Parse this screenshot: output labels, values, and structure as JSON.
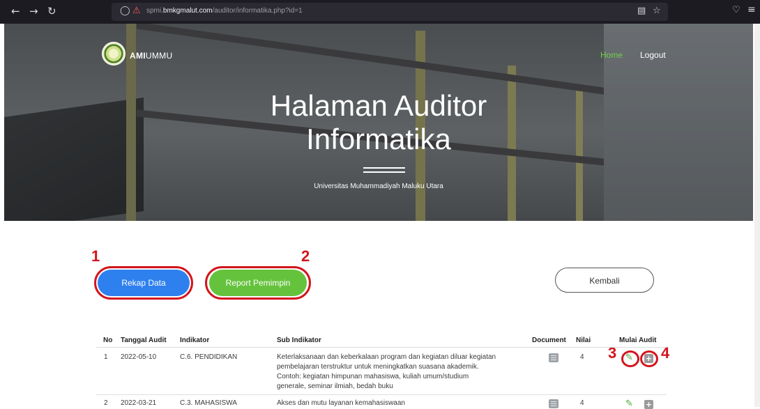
{
  "browser": {
    "url_prefix": "spmi.",
    "url_domain": "bmkgmalut.com",
    "url_path": "/auditor/informatika.php?id=1",
    "back_icon": "arrow-left-icon",
    "forward_icon": "arrow-right-icon",
    "reload_icon": "reload-icon"
  },
  "nav": {
    "brand_bold": "AMI",
    "brand_rest": "UMMU",
    "home": "Home",
    "logout": "Logout"
  },
  "hero": {
    "title_line1": "Halaman Auditor",
    "title_line2": "Informatika",
    "subtitle": "Universitas Muhammadiyah Maluku Utara"
  },
  "buttons": {
    "rekap": "Rekap Data",
    "report": "Report Pemimpin",
    "kembali": "Kembali"
  },
  "annotations": [
    "1",
    "2",
    "3",
    "4"
  ],
  "table": {
    "headers": [
      "No",
      "Tanggal Audit",
      "Indikator",
      "Sub Indikator",
      "Document",
      "Nilai",
      "Mulai Audit"
    ],
    "rows": [
      {
        "no": "1",
        "tanggal": "2022-05-10",
        "indikator": "C.6. PENDIDIKAN",
        "sub": [
          "Keterlaksanaan dan keberkalaan program dan kegiatan diluar kegiatan",
          "pembelajaran terstruktur untuk meningkatkan suasana akademik.",
          "Contoh: kegiatan himpunan mahasiswa, kuliah umum/studium",
          "generale, seminar ilmiah, bedah buku"
        ],
        "nilai": "4"
      },
      {
        "no": "2",
        "tanggal": "2022-03-21",
        "indikator": "C.3. MAHASISWA",
        "sub": [
          "Akses dan mutu layanan kemahasiswaan"
        ],
        "nilai": "4"
      }
    ]
  },
  "colors": {
    "accent_blue": "#2f80ef",
    "accent_green": "#65c23d",
    "annotation_red": "#d3151d",
    "home_green": "#72d14b"
  }
}
